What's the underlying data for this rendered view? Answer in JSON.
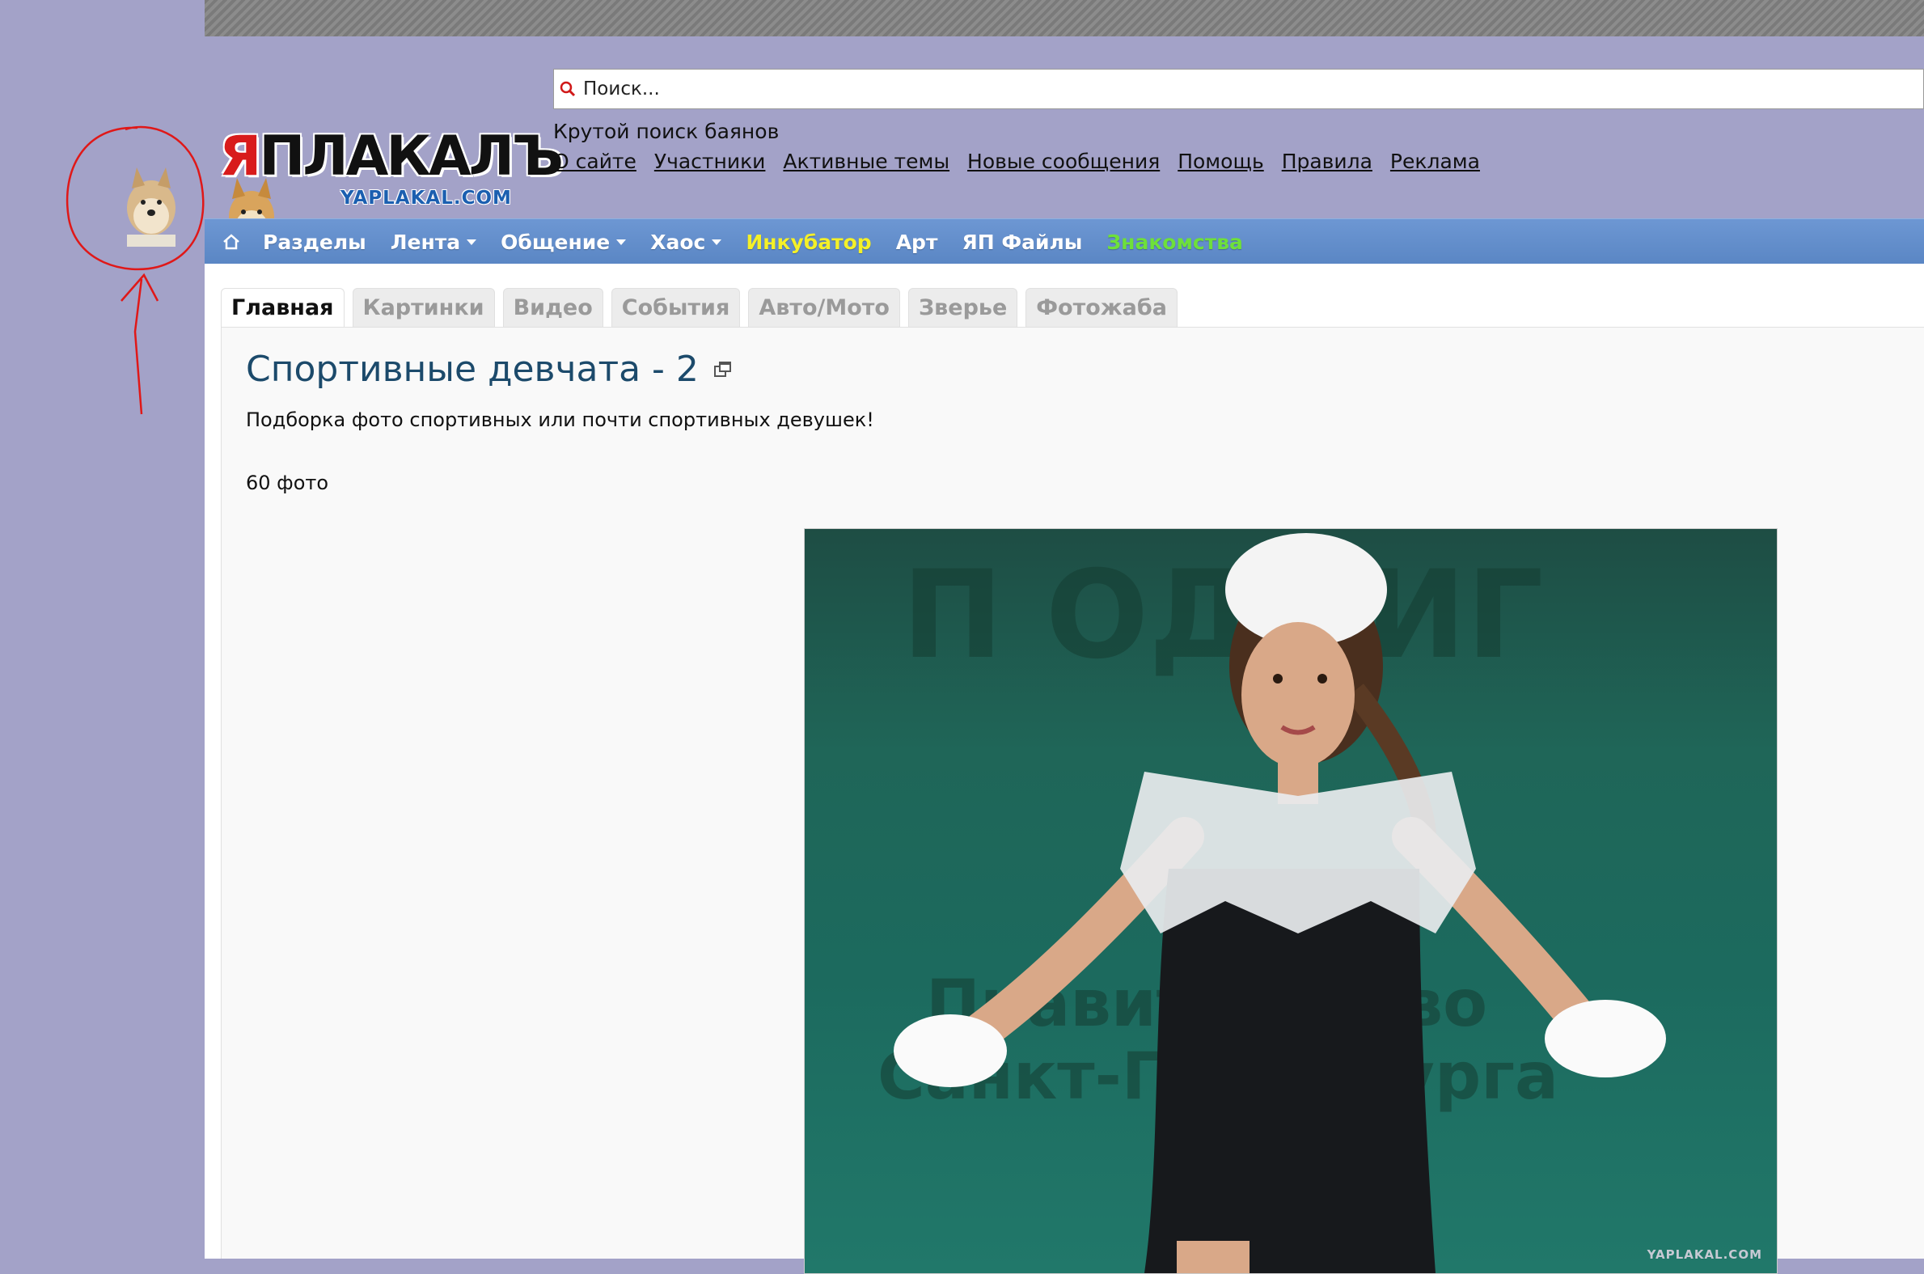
{
  "search": {
    "placeholder": "Поиск..."
  },
  "header": {
    "logo_main": "ЯПЛАКАЛЪ",
    "logo_sub": "YAPLAKAL.COM",
    "tagline": "Крутой поиск баянов",
    "links": [
      "О сайте",
      "Участники",
      "Активные темы",
      "Новые сообщения",
      "Помощь",
      "Правила",
      "Реклама"
    ]
  },
  "nav": {
    "items": [
      {
        "label": "Разделы",
        "color": "#ffffff",
        "dropdown": false
      },
      {
        "label": "Лента",
        "color": "#ffffff",
        "dropdown": true
      },
      {
        "label": "Общение",
        "color": "#ffffff",
        "dropdown": true
      },
      {
        "label": "Хаос",
        "color": "#ffffff",
        "dropdown": true
      },
      {
        "label": "Инкубатор",
        "color": "#f4f028",
        "dropdown": false
      },
      {
        "label": "Арт",
        "color": "#ffffff",
        "dropdown": false
      },
      {
        "label": "ЯП Файлы",
        "color": "#ffffff",
        "dropdown": false
      },
      {
        "label": "Знакомства",
        "color": "#6ee03a",
        "dropdown": false
      }
    ]
  },
  "tabs": [
    {
      "label": "Главная",
      "active": true
    },
    {
      "label": "Картинки",
      "active": false
    },
    {
      "label": "Видео",
      "active": false
    },
    {
      "label": "События",
      "active": false
    },
    {
      "label": "Авто/Мото",
      "active": false
    },
    {
      "label": "Зверье",
      "active": false
    },
    {
      "label": "Фотожаба",
      "active": false
    }
  ],
  "post": {
    "title": "Спортивные девчата - 2",
    "description": "Подборка фото спортивных или почти спортивных девушек!",
    "count": "60 фото",
    "watermark": "YAPLAKAL.COM"
  },
  "icons": {
    "search": "search-icon",
    "home": "home-icon",
    "popout": "popout-icon"
  }
}
